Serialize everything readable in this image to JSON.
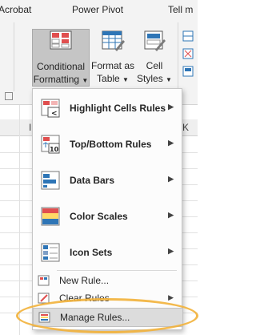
{
  "ribbon_tabs": [
    "Acrobat",
    "Power Pivot",
    "Tell m"
  ],
  "ribbon_buttons": {
    "conditional_formatting": {
      "line1": "Conditional",
      "line2": "Formatting"
    },
    "format_as_table": {
      "line1": "Format as",
      "line2": "Table"
    },
    "cell_styles": {
      "line1": "Cell",
      "line2": "Styles"
    }
  },
  "column_headers": [
    "I",
    "K"
  ],
  "menu": {
    "items": [
      {
        "label": "Highlight Cells Rules",
        "icon": "highlight-cells-icon",
        "submenu": true
      },
      {
        "label": "Top/Bottom Rules",
        "icon": "top-bottom-icon",
        "submenu": true
      },
      {
        "label": "Data Bars",
        "icon": "data-bars-icon",
        "submenu": true
      },
      {
        "label": "Color Scales",
        "icon": "color-scales-icon",
        "submenu": true
      },
      {
        "label": "Icon Sets",
        "icon": "icon-sets-icon",
        "submenu": true
      }
    ],
    "small_items": [
      {
        "label": "New Rule...",
        "icon": "new-rule-icon",
        "submenu": false
      },
      {
        "label": "Clear Rules",
        "icon": "clear-rules-icon",
        "submenu": true
      },
      {
        "label": "Manage Rules...",
        "icon": "manage-rules-icon",
        "submenu": false
      }
    ]
  },
  "colors": {
    "highlight_ring": "#f2b13a",
    "accent_blue": "#2e75b6",
    "accent_red": "#e04f4f"
  }
}
